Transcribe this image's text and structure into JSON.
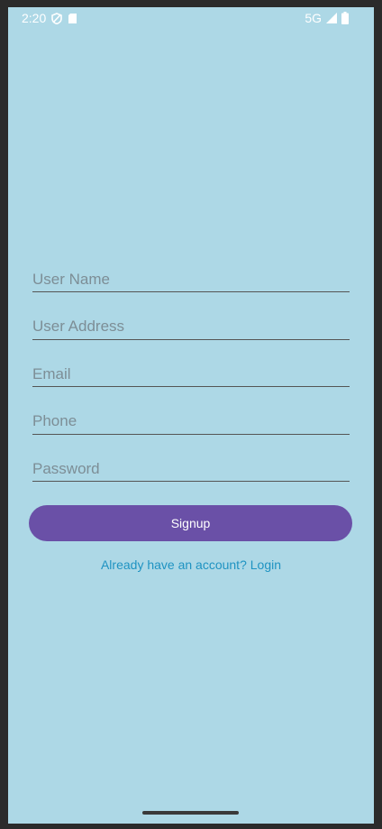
{
  "status_bar": {
    "time": "2:20",
    "icons_left": [
      "shield-off-icon",
      "sd-card-icon"
    ],
    "network": "5G",
    "icons_right": [
      "signal-icon",
      "battery-icon"
    ]
  },
  "form": {
    "fields": [
      {
        "name": "user-name",
        "placeholder": "User Name",
        "value": ""
      },
      {
        "name": "user-address",
        "placeholder": "User Address",
        "value": ""
      },
      {
        "name": "email",
        "placeholder": "Email",
        "value": ""
      },
      {
        "name": "phone",
        "placeholder": "Phone",
        "value": ""
      },
      {
        "name": "password",
        "placeholder": "Password",
        "value": ""
      }
    ],
    "submit_label": "Signup",
    "login_link": "Already have an account? Login"
  },
  "colors": {
    "background": "#add8e6",
    "button": "#6a50a7",
    "button_text": "#ffffff",
    "link": "#1f93c2",
    "placeholder": "#7d8e96",
    "underline": "#555555"
  }
}
